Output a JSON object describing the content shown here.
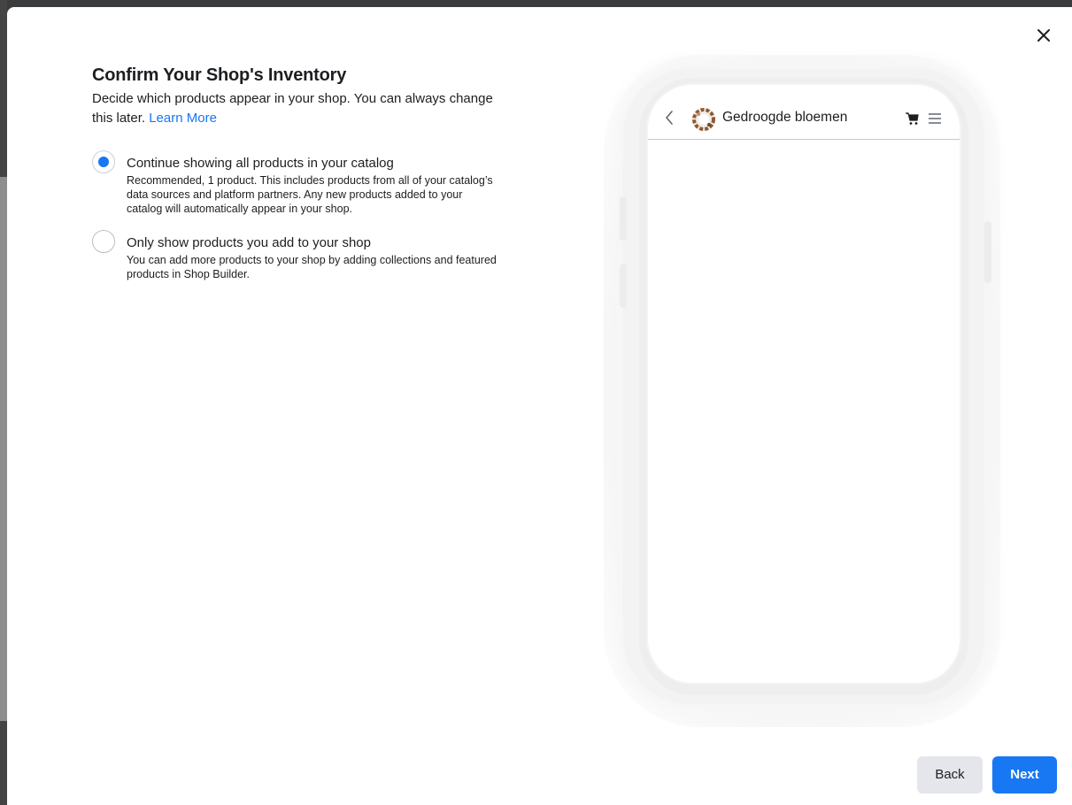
{
  "dialog": {
    "title": "Confirm Your Shop's Inventory",
    "subtitle": "Decide which products appear in your shop. You can always change this later.",
    "learn_more": "Learn More"
  },
  "options": [
    {
      "label": "Continue showing all products in your catalog",
      "description": "Recommended, 1 product. This includes products from all of your catalog’s data sources and platform partners. Any new products added to your catalog will automatically appear in your shop.",
      "selected": true
    },
    {
      "label": "Only show products you add to your shop",
      "description": "You can add more products to your shop by adding collections and featured products in Shop Builder.",
      "selected": false
    }
  ],
  "preview": {
    "shop_name": "Gedroogde bloemen",
    "icons": [
      "back-chevron-icon",
      "shop-logo",
      "cart-icon",
      "menu-icon"
    ]
  },
  "footer": {
    "back_label": "Back",
    "next_label": "Next"
  },
  "colors": {
    "accent": "#1877f2",
    "secondary_button": "#e4e6eb",
    "text": "#1c1e21"
  }
}
